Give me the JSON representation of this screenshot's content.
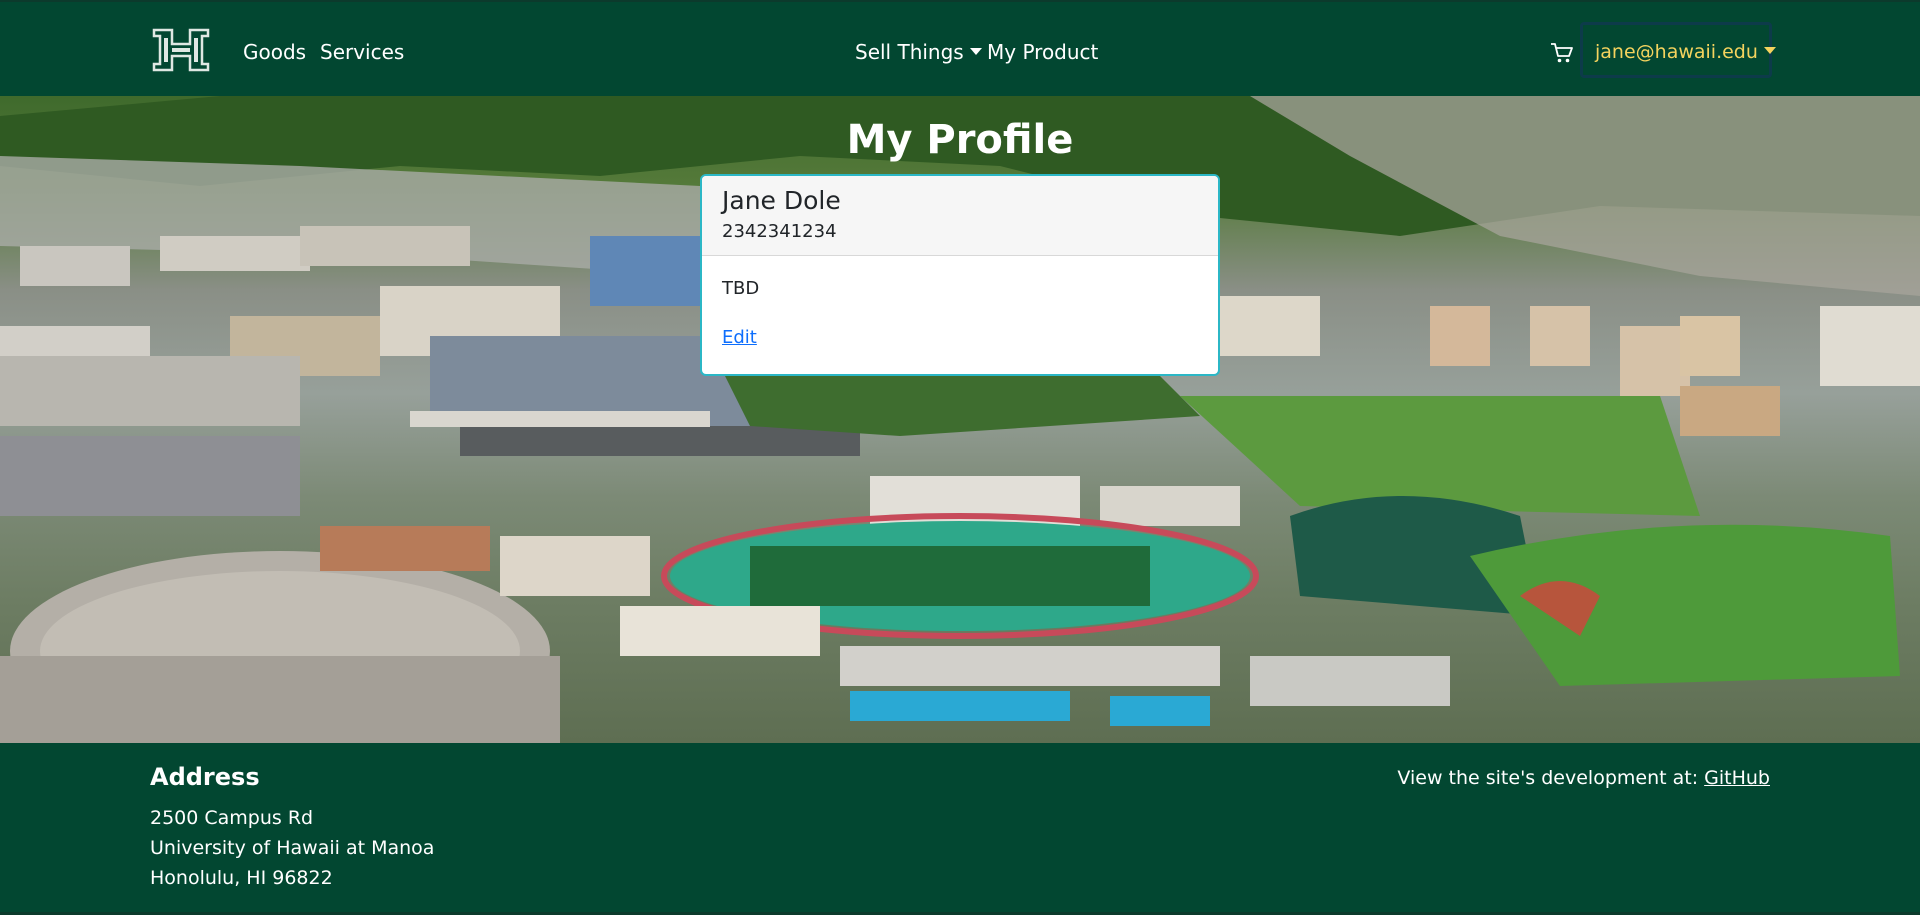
{
  "navbar": {
    "logo_icon": "hawaii-h-logo",
    "links": {
      "goods": "Goods",
      "services": "Services",
      "sell_things": "Sell Things",
      "my_product": "My Product"
    },
    "cart_icon": "shopping-cart-icon",
    "user": "jane@hawaii.edu"
  },
  "main": {
    "title": "My Profile",
    "profile": {
      "name": "Jane Dole",
      "phone": "2342341234",
      "description": "TBD",
      "edit_label": "Edit"
    }
  },
  "footer": {
    "heading": "Address",
    "address_lines": [
      "2500 Campus Rd",
      "University of Hawaii at Manoa",
      "Honolulu, HI 96822"
    ],
    "dev_text": "View the site's development at: ",
    "github_label": "GitHub"
  },
  "colors": {
    "brand_green": "#024731",
    "user_accent": "#f4d35e",
    "card_border": "#2bb7c6",
    "link_blue": "#0d6efd"
  }
}
